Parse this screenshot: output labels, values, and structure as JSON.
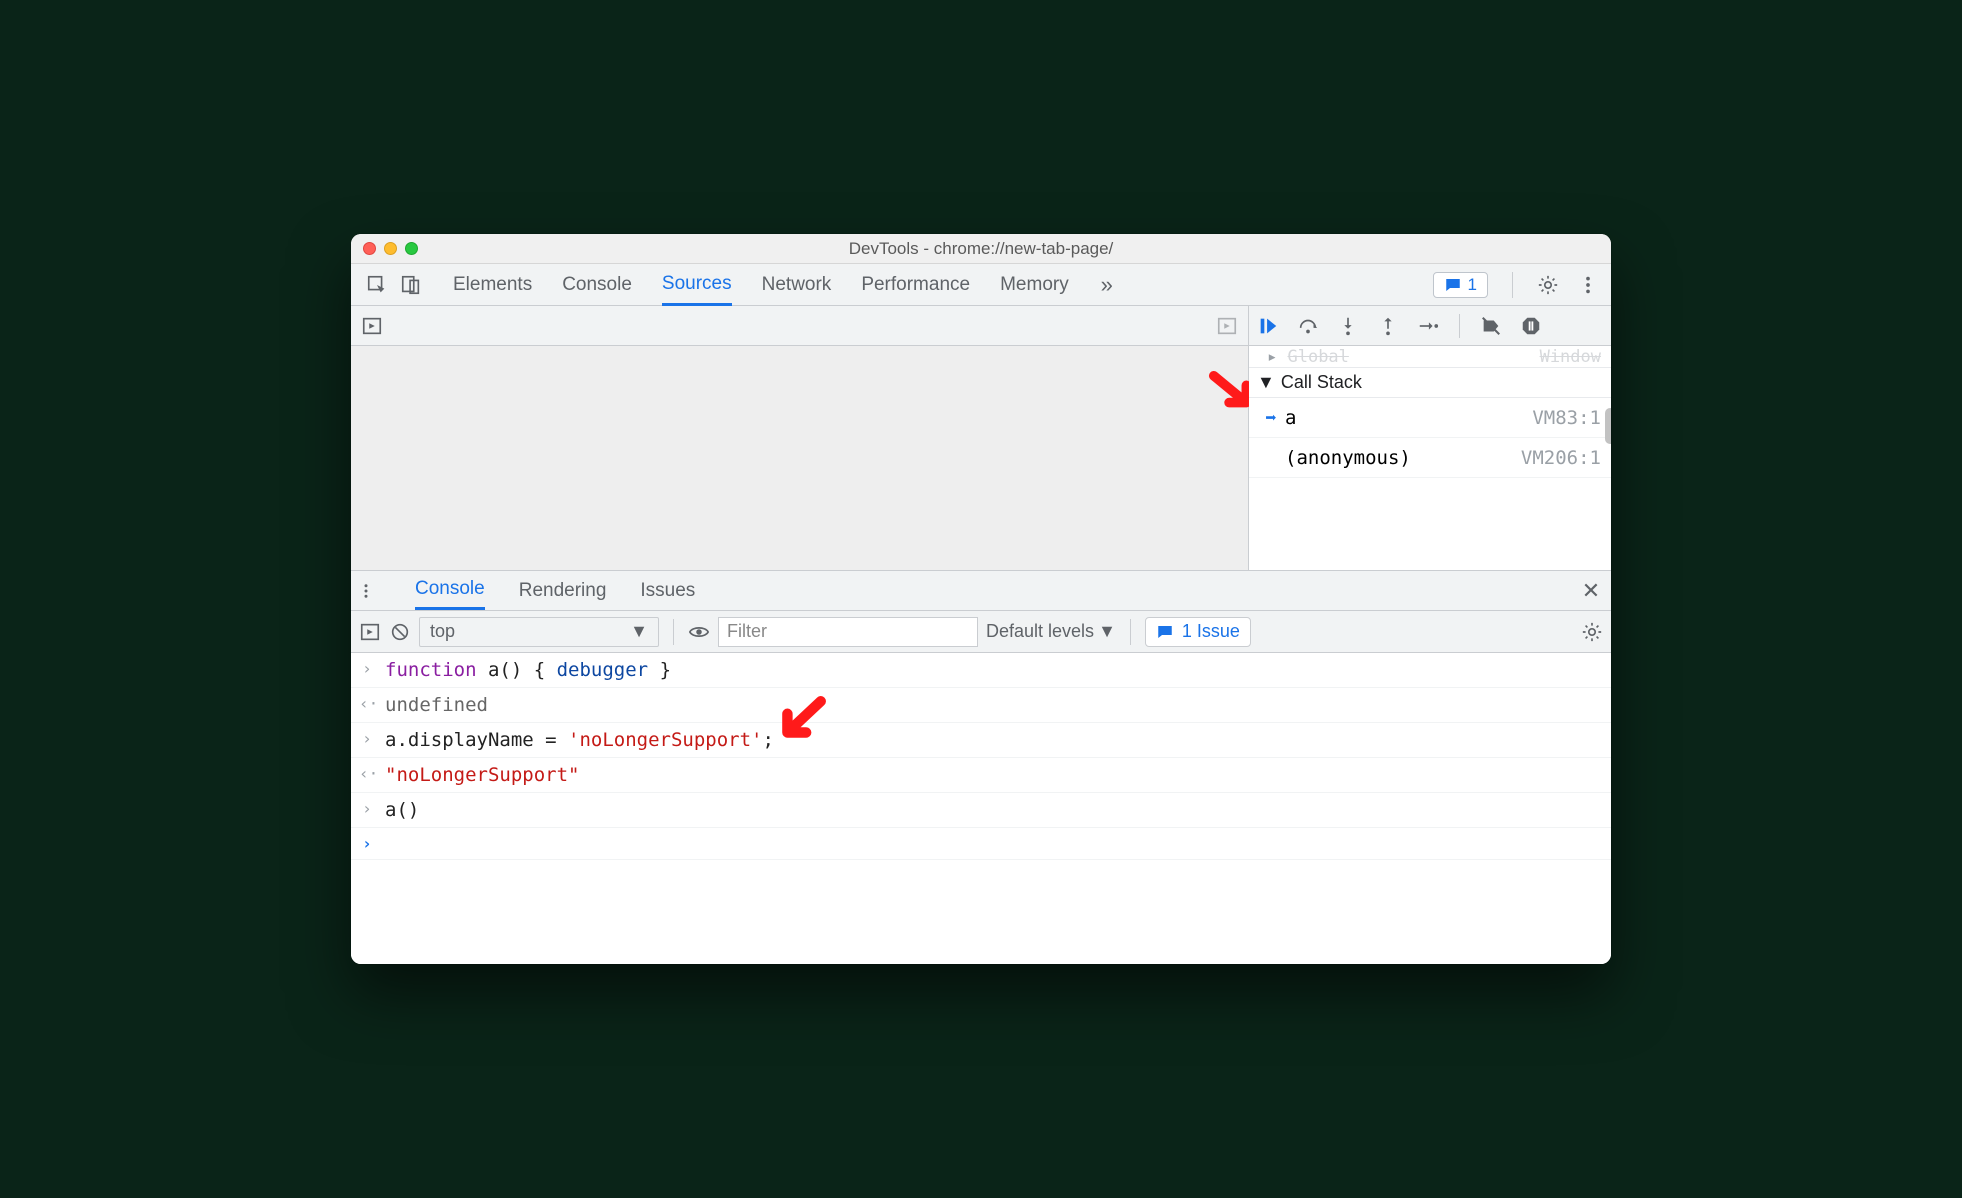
{
  "window": {
    "title": "DevTools - chrome://new-tab-page/"
  },
  "topTabs": {
    "items": [
      "Elements",
      "Console",
      "Sources",
      "Network",
      "Performance",
      "Memory"
    ],
    "activeIndex": 2,
    "overflowGlyph": "»",
    "badgeCount": "1"
  },
  "sidePanel": {
    "scopeHintLeft": "Global",
    "scopeHintRight": "Window",
    "sectionTitle": "Call Stack",
    "frames": [
      {
        "name": "a",
        "location": "VM83:1",
        "current": true
      },
      {
        "name": "(anonymous)",
        "location": "VM206:1",
        "current": false
      }
    ]
  },
  "drawer": {
    "tabs": [
      "Console",
      "Rendering",
      "Issues"
    ],
    "activeIndex": 0
  },
  "consoleToolbar": {
    "context": "top",
    "filterPlaceholder": "Filter",
    "levels": "Default levels",
    "issuePill": "1 Issue"
  },
  "consoleLines": [
    {
      "type": "input",
      "gutter": "›",
      "segments": [
        {
          "t": "function ",
          "c": "tk-kw"
        },
        {
          "t": "a",
          "c": "tk-plain"
        },
        {
          "t": "() { ",
          "c": "tk-plain"
        },
        {
          "t": "debugger",
          "c": "tk-debug"
        },
        {
          "t": " }",
          "c": "tk-plain"
        }
      ]
    },
    {
      "type": "output",
      "gutter": "‹·",
      "segments": [
        {
          "t": "undefined",
          "c": "tk-undef"
        }
      ]
    },
    {
      "type": "input",
      "gutter": "›",
      "segments": [
        {
          "t": "a.displayName = ",
          "c": "tk-plain"
        },
        {
          "t": "'noLongerSupport'",
          "c": "tk-str"
        },
        {
          "t": ";",
          "c": "tk-plain"
        }
      ]
    },
    {
      "type": "output",
      "gutter": "‹·",
      "segments": [
        {
          "t": "\"noLongerSupport\"",
          "c": "tk-ret"
        }
      ]
    },
    {
      "type": "input",
      "gutter": "›",
      "segments": [
        {
          "t": "a()",
          "c": "tk-plain"
        }
      ]
    },
    {
      "type": "prompt",
      "gutter": "›",
      "segments": []
    }
  ],
  "colors": {
    "accent": "#1a73e8",
    "annotation": "#ff1a1a"
  }
}
